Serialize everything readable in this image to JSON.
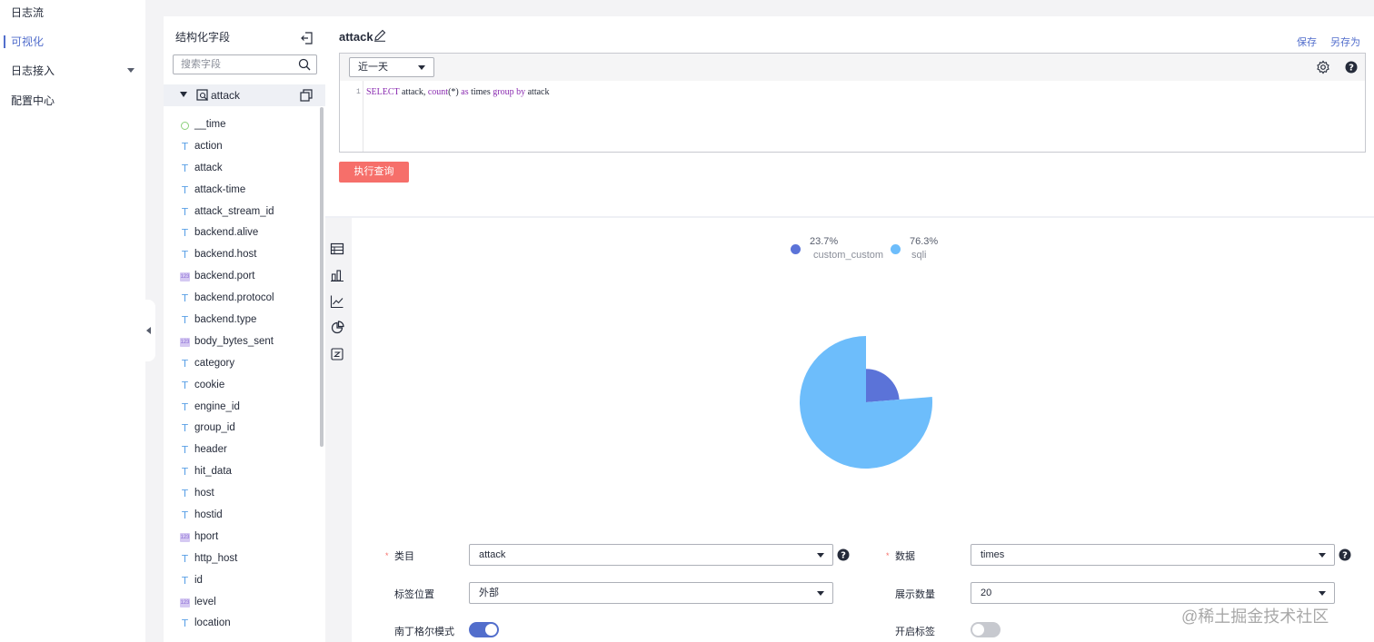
{
  "nav": {
    "items": [
      {
        "label": "日志流",
        "active": false
      },
      {
        "label": "可视化",
        "active": true
      },
      {
        "label": "日志接入",
        "active": false,
        "has_caret": true
      },
      {
        "label": "配置中心",
        "active": false
      }
    ]
  },
  "fields_panel": {
    "title": "结构化字段",
    "search_placeholder": "搜索字段",
    "selected_field": "attack",
    "fields": [
      {
        "name": "__time",
        "type": "time"
      },
      {
        "name": "action",
        "type": "text"
      },
      {
        "name": "attack",
        "type": "text"
      },
      {
        "name": "attack-time",
        "type": "text"
      },
      {
        "name": "attack_stream_id",
        "type": "text"
      },
      {
        "name": "backend.alive",
        "type": "text"
      },
      {
        "name": "backend.host",
        "type": "text"
      },
      {
        "name": "backend.port",
        "type": "number"
      },
      {
        "name": "backend.protocol",
        "type": "text"
      },
      {
        "name": "backend.type",
        "type": "text"
      },
      {
        "name": "body_bytes_sent",
        "type": "number"
      },
      {
        "name": "category",
        "type": "text"
      },
      {
        "name": "cookie",
        "type": "text"
      },
      {
        "name": "engine_id",
        "type": "text"
      },
      {
        "name": "group_id",
        "type": "text"
      },
      {
        "name": "header",
        "type": "text"
      },
      {
        "name": "hit_data",
        "type": "text"
      },
      {
        "name": "host",
        "type": "text"
      },
      {
        "name": "hostid",
        "type": "text"
      },
      {
        "name": "hport",
        "type": "number"
      },
      {
        "name": "http_host",
        "type": "text"
      },
      {
        "name": "id",
        "type": "text"
      },
      {
        "name": "level",
        "type": "number"
      },
      {
        "name": "location",
        "type": "text"
      }
    ]
  },
  "query": {
    "title": "attack",
    "save_label": "保存",
    "save_as_label": "另存为",
    "time_range": "近一天",
    "line_number": "1",
    "sql": {
      "select": "SELECT",
      "p1": " attack, ",
      "count": "count",
      "p2": "(*) ",
      "as": "as",
      "p3": " times ",
      "group": "group",
      "p4": " ",
      "by": "by",
      "p5": " attack"
    },
    "run_label": "执行查询"
  },
  "chart_data": {
    "type": "pie",
    "slices": [
      {
        "label": "custom_custom",
        "percent": 23.7,
        "percent_label": "23.7%",
        "color": "#5b73d8"
      },
      {
        "label": "sqli",
        "percent": 76.3,
        "percent_label": "76.3%",
        "color": "#6dbdfb"
      }
    ],
    "legend_position": "top"
  },
  "settings": {
    "category_label": "类目",
    "category_value": "attack",
    "data_label": "数据",
    "data_value": "times",
    "label_pos_label": "标签位置",
    "label_pos_value": "外部",
    "show_count_label": "展示数量",
    "show_count_value": "20",
    "nightingale_label": "南丁格尔模式",
    "nightingale_on": true,
    "show_label_label": "开启标签",
    "show_label_on": false
  },
  "watermark": "@稀土掘金技术社区",
  "colors": {
    "accent": "#526ecc",
    "run_button": "#f66f6a",
    "slice_custom": "#5b73d8",
    "slice_sqli": "#6dbdfb"
  }
}
